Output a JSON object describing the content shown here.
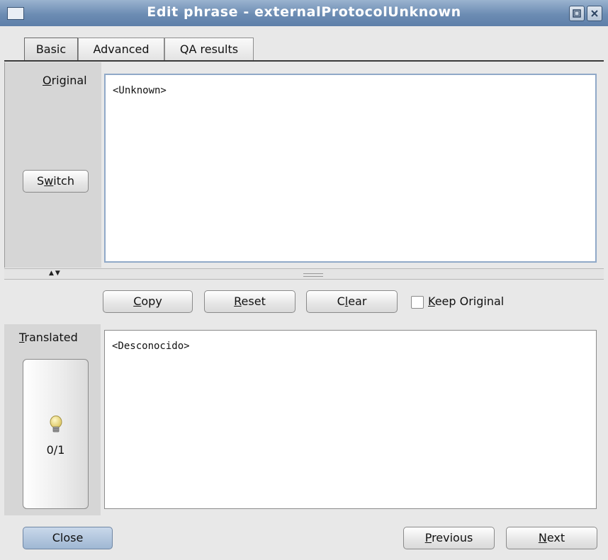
{
  "window": {
    "title": "Edit phrase - externalProtocolUnknown"
  },
  "tabs": [
    {
      "label": "Basic",
      "active": true
    },
    {
      "label": "Advanced",
      "active": false
    },
    {
      "label": "QA results",
      "active": false
    }
  ],
  "original": {
    "label_mnemonic": "O",
    "label_rest": "riginal",
    "text": "<Unknown>",
    "switch_pre": "S",
    "switch_mn": "w",
    "switch_post": "itch"
  },
  "actions": {
    "copy_mn": "C",
    "copy_rest": "opy",
    "reset_mn": "R",
    "reset_rest": "eset",
    "clear_pre": "C",
    "clear_mn": "l",
    "clear_post": "ear",
    "keep_mn": "K",
    "keep_rest": "eep Original",
    "keep_checked": false
  },
  "translated": {
    "label_mnemonic": "T",
    "label_rest": "ranslated",
    "text": "<Desconocido>",
    "suggestion_count": "0/1",
    "suggestion_icon": "lightbulb-icon"
  },
  "footer": {
    "close_label": "Close",
    "previous_mn": "P",
    "previous_rest": "revious",
    "next_mn": "N",
    "next_rest": "ext"
  },
  "colors": {
    "titlebar": "#6c8cb3",
    "focus_border": "#90a9c8",
    "close_button": "#a9bfd9"
  }
}
